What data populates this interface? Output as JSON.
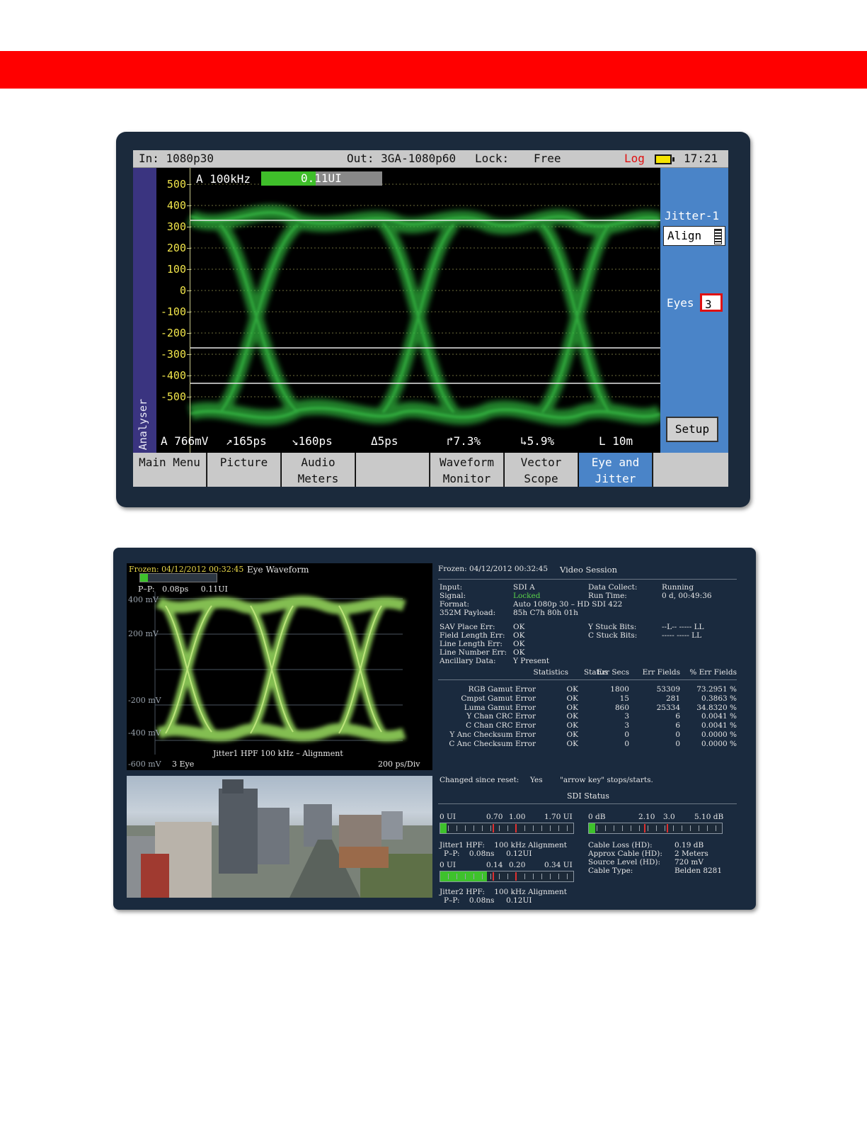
{
  "screen1": {
    "status_bar": {
      "input": "In: 1080p30",
      "output": "Out: 3GA-1080p60",
      "lock_label": "Lock:",
      "lock_value": "Free",
      "log": "Log",
      "time": "17:21"
    },
    "side_tab": "Analyser",
    "jitter_readout": {
      "label": "A 100kHz",
      "value": "0.11UI",
      "fill_fraction": 0.45
    },
    "y_axis_labels": [
      "500",
      "400",
      "300",
      "200",
      "100",
      "0",
      "-100",
      "-200",
      "-300",
      "-400",
      "-500"
    ],
    "measurements": [
      "A 766mV",
      "↗165ps",
      "↘160ps",
      "Δ5ps",
      "↱7.3%",
      "↳5.9%",
      "L 10m"
    ],
    "right_panel": {
      "jitter_label": "Jitter-1",
      "mode_value": "Align",
      "eyes_label": "Eyes",
      "eyes_value": "3",
      "setup_label": "Setup"
    },
    "softkeys": [
      {
        "line1": "Main Menu",
        "line2": ""
      },
      {
        "line1": "Picture",
        "line2": ""
      },
      {
        "line1": "Audio",
        "line2": "Meters"
      },
      {
        "line1": "",
        "line2": ""
      },
      {
        "line1": "Waveform",
        "line2": "Monitor"
      },
      {
        "line1": "Vector",
        "line2": "Scope"
      },
      {
        "line1": "Eye and",
        "line2": "Jitter"
      },
      {
        "line1": "",
        "line2": ""
      }
    ],
    "active_softkey": 6,
    "colors": {
      "trace": "#2fae3a",
      "axis_label": "#f0e44a",
      "panel": "#4a84c8",
      "side_tab": "#3a3480"
    }
  },
  "screen2": {
    "eye_window": {
      "frozen": "Frozen: 04/12/2012 00:32:45",
      "title": "Eye Waveform",
      "pp": "P–P:   0.08ps     0.11UI",
      "y_labels": [
        "400 mV",
        "200 mV",
        "-200 mV",
        "-400 mV",
        "-600 mV"
      ],
      "footer_left": "3 Eye",
      "footer_center": "Jitter1 HPF 100 kHz – Alignment",
      "footer_right": "200 ps/Div",
      "fill_fraction": 0.1
    },
    "session": {
      "frozen": "Frozen: 04/12/2012 00:32:45",
      "title": "Video Session",
      "info": [
        {
          "label": "Input:",
          "value": "SDI A"
        },
        {
          "label": "Signal:",
          "value": "Locked"
        },
        {
          "label": "Format:",
          "value": "Auto 1080p 30 – HD SDI 422"
        },
        {
          "label": "352M Payload:",
          "value": "85h C7h 80h 01h"
        }
      ],
      "collect": [
        {
          "label": "Data Collect:",
          "value": "Running"
        },
        {
          "label": "Run Time:",
          "value": "0 d, 00:49:36"
        }
      ],
      "checks": [
        {
          "label": "SAV Place Err:",
          "value": "OK"
        },
        {
          "label": "Field Length Err:",
          "value": "OK"
        },
        {
          "label": "Line Length Err:",
          "value": "OK"
        },
        {
          "label": "Line Number Err:",
          "value": "OK"
        },
        {
          "label": "Ancillary Data:",
          "value": "Y Present"
        }
      ],
      "stuck": [
        {
          "label": "Y Stuck Bits:",
          "value": "--L-- ----- LL"
        },
        {
          "label": "C Stuck Bits:",
          "value": "----- ----- LL"
        }
      ],
      "stats_headers": [
        "Statistics",
        "Status",
        "Err Secs",
        "Err Fields",
        "% Err Fields"
      ],
      "stats_rows": [
        [
          "RGB Gamut Error",
          "OK",
          "1800",
          "53309",
          "73.2951 %"
        ],
        [
          "Cmpst Gamut Error",
          "OK",
          "15",
          "281",
          "0.3863 %"
        ],
        [
          "Luma Gamut Error",
          "OK",
          "860",
          "25334",
          "34.8320 %"
        ],
        [
          "Y Chan CRC Error",
          "OK",
          "3",
          "6",
          "0.0041 %"
        ],
        [
          "C Chan CRC Error",
          "OK",
          "3",
          "6",
          "0.0041 %"
        ],
        [
          "Y Anc Checksum Error",
          "OK",
          "0",
          "0",
          "0.0000 %"
        ],
        [
          "C Anc Checksum Error",
          "OK",
          "0",
          "0",
          "0.0000 %"
        ]
      ],
      "changed_label": "Changed since reset:",
      "changed_value": "Yes",
      "hint": "\"arrow key\" stops/starts.",
      "sdi_status_title": "SDI Status",
      "meter1": {
        "scale": [
          "0 UI",
          "0.70",
          "1.00",
          "1.70 UI"
        ],
        "fill_fraction": 0.05,
        "line1": "Jitter1 HPF:    100 kHz Alignment",
        "line2": "P–P:    0.08ns     0.12UI"
      },
      "meter2": {
        "scale": [
          "0 UI",
          "0.14",
          "0.20",
          "0.34 UI"
        ],
        "fill_fraction": 0.35,
        "line1": "Jitter2 HPF:    100 kHz Alignment",
        "line2": "P–P:    0.08ns     0.12UI"
      },
      "meter3": {
        "scale": [
          "0 dB",
          "2.10",
          "3.0",
          "5.10 dB"
        ],
        "fill_fraction": 0.05
      },
      "cable": [
        {
          "label": "Cable Loss (HD):",
          "value": "0.19 dB"
        },
        {
          "label": "Approx Cable (HD):",
          "value": "2 Meters"
        },
        {
          "label": "Source Level (HD):",
          "value": "720 mV"
        },
        {
          "label": "Cable Type:",
          "value": "Belden 8281"
        }
      ]
    }
  }
}
